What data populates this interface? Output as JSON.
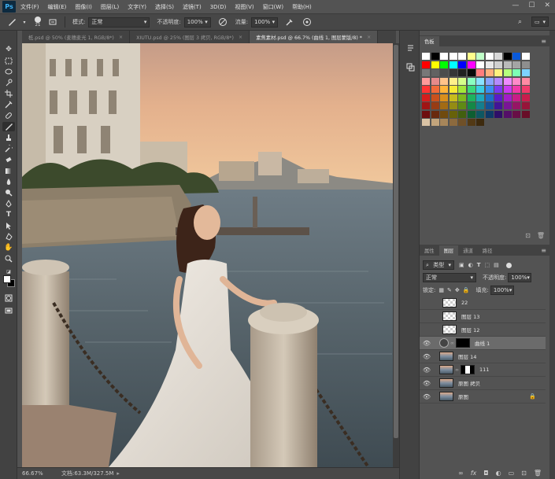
{
  "menubar": {
    "logo": "Ps",
    "items": [
      "文件(F)",
      "编辑(E)",
      "图像(I)",
      "图层(L)",
      "文字(Y)",
      "选择(S)",
      "滤镜(T)",
      "3D(D)",
      "视图(V)",
      "窗口(W)",
      "帮助(H)"
    ],
    "window_controls": [
      "—",
      "☐",
      "✕"
    ]
  },
  "optionsbar": {
    "brush_size": "21",
    "mode_label": "模式:",
    "mode_value": "正常",
    "opacity_label": "不透明度:",
    "opacity_value": "100%",
    "flow_label": "流量:",
    "flow_value": "100%"
  },
  "tabs": [
    {
      "label": "柢.psd @ 50% (麦穗麦光 1, RGB/8*)",
      "active": false
    },
    {
      "label": "XIUTU.psd @ 25% (图层 3 拷贝, RGB/8*)",
      "active": false
    },
    {
      "label": "素焦素材.psd @ 66.7% (曲线 1, 图层蒙版/8) *",
      "active": true
    }
  ],
  "statusbar": {
    "zoom": "66.67%",
    "doc_info": "文档:63.3M/327.5M"
  },
  "swatches": {
    "tab_label": "色板",
    "colors": [
      [
        "#ffffff",
        "#000000",
        "#ffffff",
        "#ffffff",
        "#ffffff",
        "#fffe8c",
        "#c0ffc8",
        "#ffffff",
        "#d8d8d8",
        "#000000",
        "#0a5adb",
        "#ffffff"
      ],
      [
        "#ff0000",
        "#ffff00",
        "#00ff00",
        "#00ffff",
        "#0000ff",
        "#ff00ff",
        "#ffffff",
        "#e8e8e8",
        "#d0d0d0",
        "#bababa",
        "#a4a4a4",
        "#8e8e8e"
      ],
      [
        "#787878",
        "#626262",
        "#4c4c4c",
        "#363636",
        "#202020",
        "#0a0a0a",
        "#ff7d7d",
        "#ffb07d",
        "#fff27d",
        "#b5ff7d",
        "#7dffb5",
        "#7dd3ff"
      ],
      [
        "#ff9a9a",
        "#e68a8a",
        "#ffc38a",
        "#fff08a",
        "#d7ff8a",
        "#8affc0",
        "#8ae2ff",
        "#8aa4ff",
        "#b48aff",
        "#ee8aff",
        "#ff8ac9",
        "#ff8aa3"
      ],
      [
        "#ff3333",
        "#f06a3a",
        "#ffb43a",
        "#f6ea35",
        "#a3e63a",
        "#3ad87a",
        "#3acde3",
        "#3a8ef0",
        "#7a3af0",
        "#c93af0",
        "#f03aa8",
        "#f03a6b"
      ],
      [
        "#d41d1d",
        "#c9511d",
        "#d98f1d",
        "#c7bc1d",
        "#7fb81d",
        "#1db35f",
        "#1da8bd",
        "#1d6ec9",
        "#5a1dc9",
        "#a31dc9",
        "#c91d87",
        "#c91d4c"
      ],
      [
        "#a01414",
        "#983c14",
        "#a36b14",
        "#948c14",
        "#5f8a14",
        "#148847",
        "#147e8e",
        "#145297",
        "#421497",
        "#7a1497",
        "#971465",
        "#971439"
      ],
      [
        "#6e0e0e",
        "#69290e",
        "#704a0e",
        "#676109",
        "#425f0e",
        "#0e5e31",
        "#0e5762",
        "#0e3968",
        "#2e0e68",
        "#540e68",
        "#680e46",
        "#680e28"
      ],
      [
        "#d9c3a5",
        "#c2a47c",
        "#a7865a",
        "#8c6a3e",
        "#6f5028",
        "#523915",
        "#3d2a0e"
      ]
    ]
  },
  "layers_panel": {
    "tabs": [
      "属性",
      "图层",
      "通道",
      "路径"
    ],
    "filter_label": "类型",
    "blend_mode": "正常",
    "opacity_label": "不透明度:",
    "opacity_value": "100%",
    "lock_label": "锁定:",
    "fill_label": "填充:",
    "fill_value": "100%",
    "layers": [
      {
        "name": "22",
        "thumb": "checker",
        "visible": false,
        "selected": false
      },
      {
        "name": "图层 13",
        "thumb": "checker",
        "visible": false,
        "selected": false
      },
      {
        "name": "图层 12",
        "thumb": "checker",
        "visible": false,
        "selected": false
      },
      {
        "name": "曲线 1",
        "thumb": "adj",
        "visible": true,
        "selected": true
      },
      {
        "name": "图层 14",
        "thumb": "photo",
        "visible": true,
        "selected": false
      },
      {
        "name": "111",
        "thumb": "photo-mask",
        "visible": true,
        "selected": false
      },
      {
        "name": "原图 拷贝",
        "thumb": "photo",
        "visible": true,
        "selected": false
      },
      {
        "name": "原图",
        "thumb": "photo",
        "visible": true,
        "selected": false,
        "locked": true
      }
    ],
    "footer_icons": [
      "link-icon",
      "fx-icon",
      "mask-icon",
      "adjustment-icon",
      "folder-icon",
      "new-layer-icon",
      "trash-icon"
    ]
  },
  "colors": {
    "ui_bg": "#535353",
    "panel_dark": "#424242",
    "accent": "#3fb2f5"
  }
}
